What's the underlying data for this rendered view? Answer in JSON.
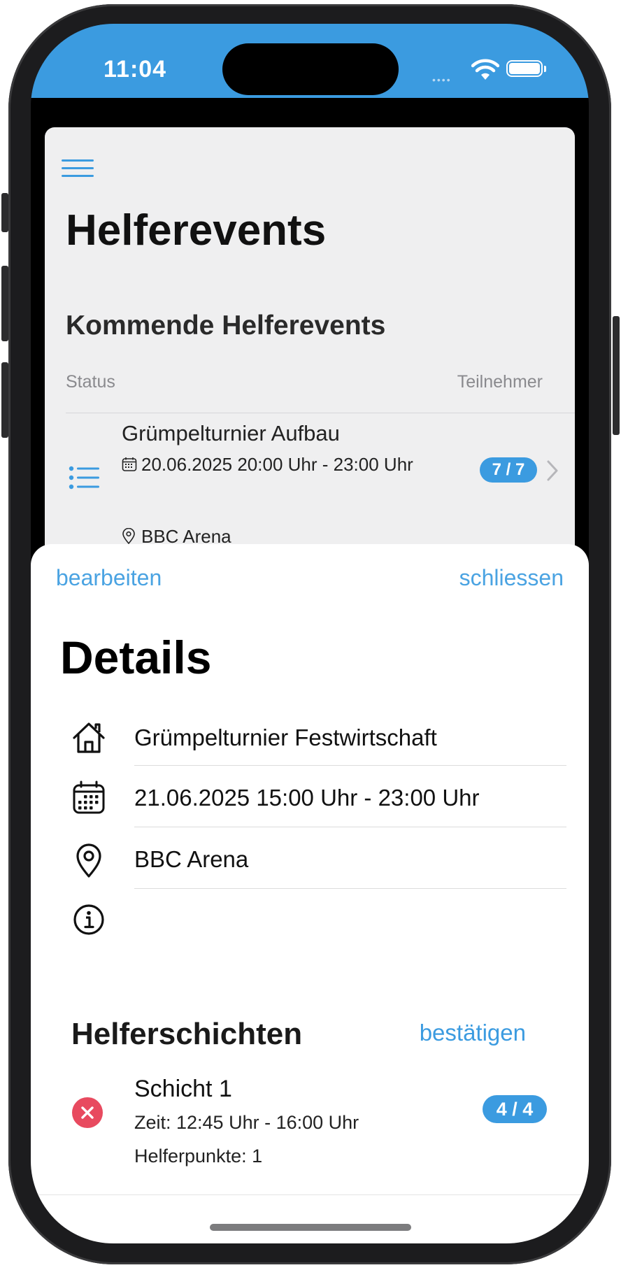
{
  "status_bar": {
    "time": "11:04"
  },
  "list": {
    "title": "Helferevents",
    "section_title": "Kommende Helferevents",
    "col_status": "Status",
    "col_participants": "Teilnehmer",
    "events": [
      {
        "title": "Grümpelturnier Aufbau",
        "datetime": "20.06.2025 20:00 Uhr - 23:00 Uhr",
        "location": "BBC Arena",
        "participants": "7 / 7"
      }
    ]
  },
  "sheet": {
    "edit_label": "bearbeiten",
    "close_label": "schliessen",
    "title": "Details",
    "name": "Grümpelturnier Festwirtschaft",
    "datetime": "21.06.2025 15:00 Uhr - 23:00 Uhr",
    "location": "BBC Arena",
    "info": "",
    "shifts_title": "Helferschichten",
    "confirm_label": "bestätigen",
    "shifts": [
      {
        "title": "Schicht 1",
        "time": "Zeit: 12:45 Uhr - 16:00 Uhr",
        "points": "Helferpunkte: 1",
        "count": "4 / 4"
      }
    ]
  },
  "colors": {
    "accent": "#3b9be0",
    "link": "#4aa3e2",
    "error": "#e84a5f"
  }
}
